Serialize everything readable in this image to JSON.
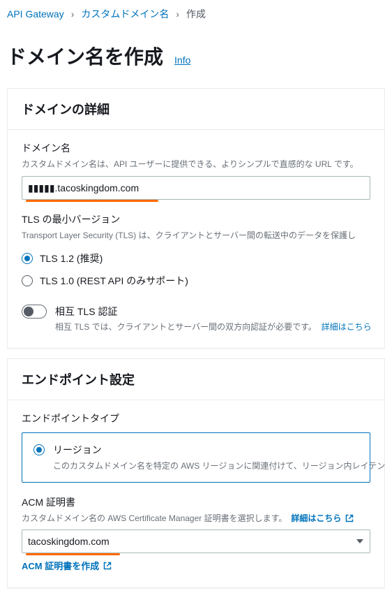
{
  "breadcrumb": {
    "items": [
      {
        "label": "API Gateway"
      },
      {
        "label": "カスタムドメイン名"
      }
    ],
    "current": "作成"
  },
  "page": {
    "title": "ドメイン名を作成",
    "info": "Info"
  },
  "details": {
    "header": "ドメインの詳細",
    "domain": {
      "label": "ドメイン名",
      "desc": "カスタムドメイン名は、API ユーザーに提供できる、よりシンプルで直感的な URL です。",
      "value": "▮▮▮▮▮.tacoskingdom.com"
    },
    "tls": {
      "label": "TLS の最小バージョン",
      "desc": "Transport Layer Security (TLS) は、クライアントとサーバー間の転送中のデータを保護し",
      "options": {
        "tls12": "TLS 1.2 (推奨)",
        "tls10": "TLS 1.0 (REST API のみサポート)"
      }
    },
    "mtls": {
      "label": "相互 TLS 認証",
      "desc": "相互 TLS では、クライアントとサーバー間の双方向認証が必要です。",
      "more": "詳細はこちら"
    }
  },
  "endpoint": {
    "header": "エンドポイント設定",
    "type": {
      "label": "エンドポイントタイプ",
      "region": {
        "title": "リージョン",
        "desc": "このカスタムドメイン名を特定の AWS リージョンに関連付けて、リージョン内レイテンシ"
      }
    },
    "acm": {
      "label": "ACM 証明書",
      "desc": "カスタムドメイン名の AWS Certificate Manager 証明書を選択します。",
      "more": "詳細はこちら",
      "value": "tacoskingdom.com",
      "create": "ACM 証明書を作成"
    }
  }
}
